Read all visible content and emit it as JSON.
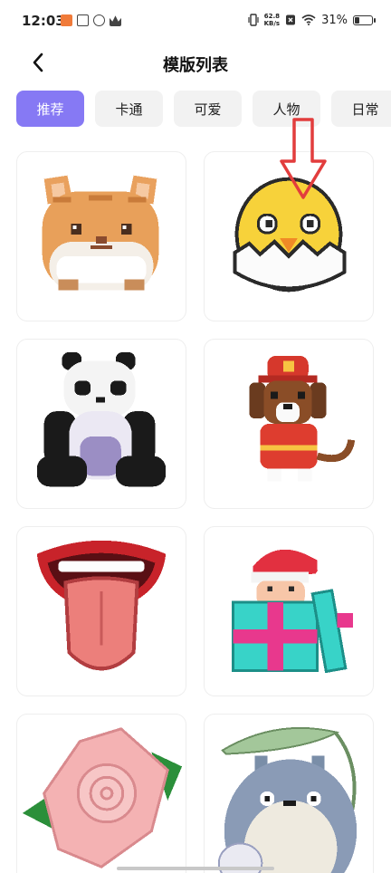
{
  "status_bar": {
    "time": "12:03",
    "network_speed": "62.8",
    "network_unit": "KB/s",
    "battery": "31%",
    "battery_level": 0.31
  },
  "header": {
    "title": "模版列表"
  },
  "tabs": [
    {
      "label": "推荐",
      "active": true
    },
    {
      "label": "卡通",
      "active": false
    },
    {
      "label": "可爱",
      "active": false
    },
    {
      "label": "人物",
      "active": false
    },
    {
      "label": "日常",
      "active": false
    }
  ],
  "templates": [
    {
      "icon": "pixel-hamster"
    },
    {
      "icon": "pixel-chick"
    },
    {
      "icon": "pixel-panda"
    },
    {
      "icon": "pixel-firefighter-dog"
    },
    {
      "icon": "pixel-mouth-tongue"
    },
    {
      "icon": "pixel-gift-elf"
    },
    {
      "icon": "pixel-rose"
    },
    {
      "icon": "pixel-totoro"
    }
  ],
  "colors": {
    "accent": "#8679f4",
    "tab_bg": "#f2f2f2",
    "arrow": "#e23d3d"
  }
}
